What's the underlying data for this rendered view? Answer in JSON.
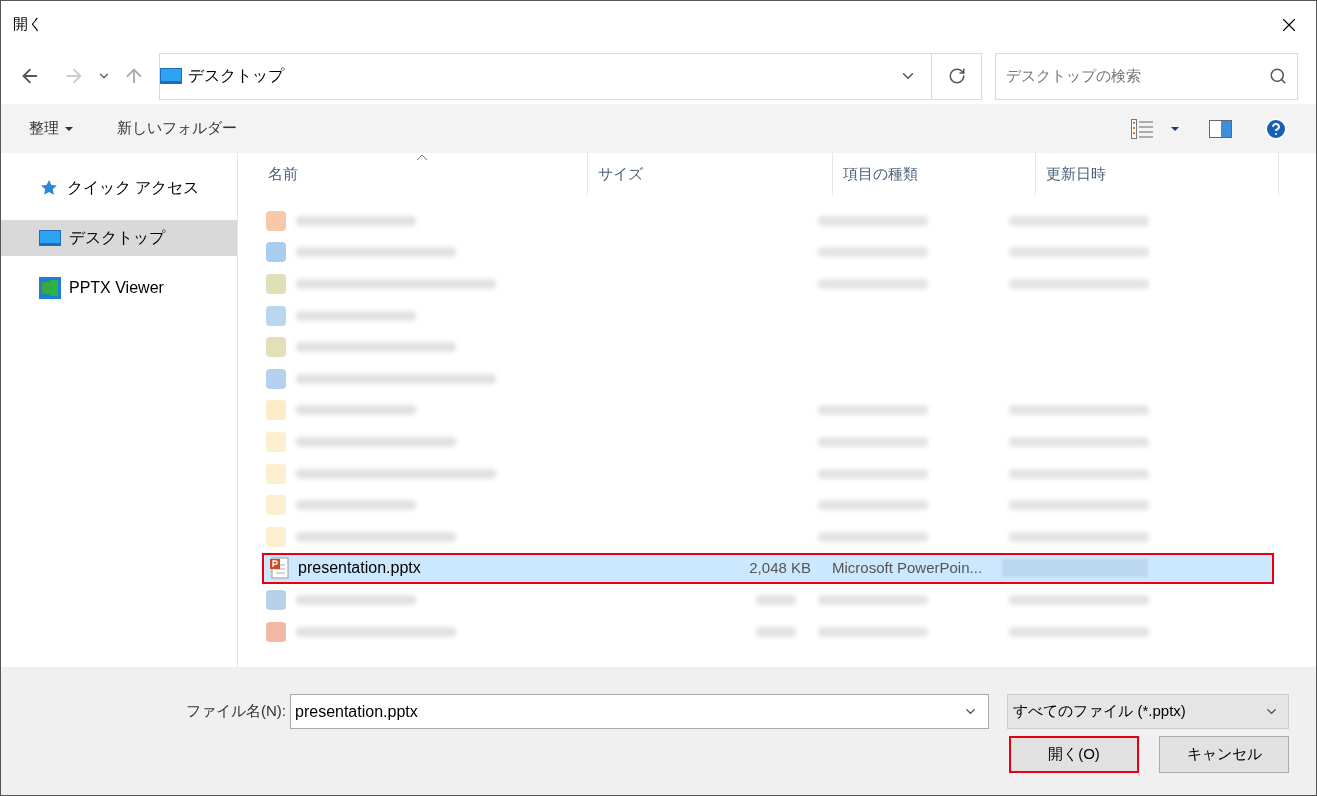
{
  "window": {
    "title": "開く"
  },
  "address": {
    "location": "デスクトップ",
    "search_placeholder": "デスクトップの検索"
  },
  "toolbar": {
    "organize": "整理",
    "new_folder": "新しいフォルダー"
  },
  "sidebar": {
    "items": [
      {
        "label": "クイック アクセス",
        "selected": false
      },
      {
        "label": "デスクトップ",
        "selected": true
      },
      {
        "label": "PPTX Viewer",
        "selected": false
      }
    ]
  },
  "table": {
    "columns": [
      "名前",
      "サイズ",
      "項目の種類",
      "更新日時"
    ],
    "rows": [
      {
        "kind": "blurred",
        "color": "#f7c9a8",
        "details": true,
        "size": false
      },
      {
        "kind": "blurred",
        "color": "#a9cdee",
        "details": true,
        "size": false
      },
      {
        "kind": "blurred",
        "color": "#dfe0b8",
        "details": true,
        "size": false
      },
      {
        "kind": "blurred",
        "color": "#b9d6f1",
        "details": false,
        "size": false
      },
      {
        "kind": "blurred",
        "color": "#e3dfb8",
        "details": false,
        "size": false
      },
      {
        "kind": "blurred",
        "color": "#b4d2ef",
        "details": false,
        "size": false
      },
      {
        "kind": "blurred",
        "color": "#fcecc8",
        "details": true,
        "size": false
      },
      {
        "kind": "blurred",
        "color": "#fcefcf",
        "details": true,
        "size": false
      },
      {
        "kind": "blurred",
        "color": "#fcefcf",
        "details": true,
        "size": false
      },
      {
        "kind": "blurred",
        "color": "#fcefcf",
        "details": true,
        "size": false
      },
      {
        "kind": "blurred",
        "color": "#fcefcf",
        "details": true,
        "size": false
      },
      {
        "kind": "file",
        "name": "presentation.pptx",
        "size": "2,048 KB",
        "type": "Microsoft PowerPoin...",
        "selected": true,
        "highlighted": true
      },
      {
        "kind": "blurred",
        "color": "#b9d0ea",
        "details": true,
        "size": true
      },
      {
        "kind": "blurred",
        "color": "#f0b9a4",
        "details": true,
        "size": true
      }
    ]
  },
  "footer": {
    "filename_label": "ファイル名(N):",
    "filename": "presentation.pptx",
    "filter": "すべてのファイル (*.pptx)",
    "buttons": [
      {
        "label": "開く(O)",
        "highlighted": true
      },
      {
        "label": "キャンセル",
        "highlighted": false
      }
    ]
  }
}
